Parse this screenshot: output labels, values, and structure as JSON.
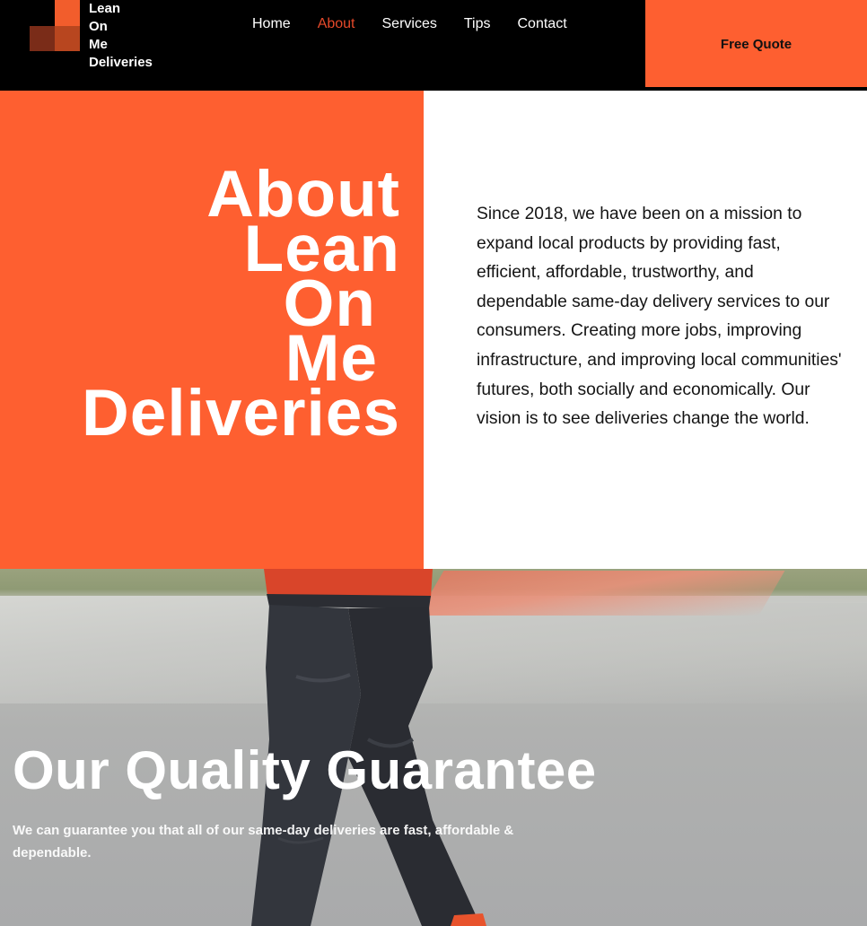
{
  "brand": {
    "logo_lines": [
      "Lean",
      "On",
      "Me",
      "Deliveries"
    ],
    "colors": {
      "orange": "#fe5f30",
      "dark_orange": "#b8461f",
      "active_nav": "#e6492a",
      "header_bg": "#000000"
    }
  },
  "nav": {
    "items": [
      {
        "label": "Home",
        "active": false
      },
      {
        "label": "About",
        "active": true
      },
      {
        "label": "Services",
        "active": false
      },
      {
        "label": "Tips",
        "active": false
      },
      {
        "label": "Contact",
        "active": false
      }
    ]
  },
  "header": {
    "cta_label": "Free Quote"
  },
  "about": {
    "title_lines": [
      "About",
      "Lean",
      "On",
      "Me",
      "Deliveries"
    ],
    "body": "Since 2018, we have been on a mission to expand local products by providing fast, efficient, affordable, trustworthy, and dependable same-day delivery services to our consumers. Creating more jobs, improving infrastructure, and improving local communities' futures, both socially and economically. Our vision is to see deliveries change the world."
  },
  "guarantee": {
    "title": "Our Quality Guarantee",
    "body": "We can guarantee you that all of our same-day deliveries are fast, affordable & dependable."
  }
}
